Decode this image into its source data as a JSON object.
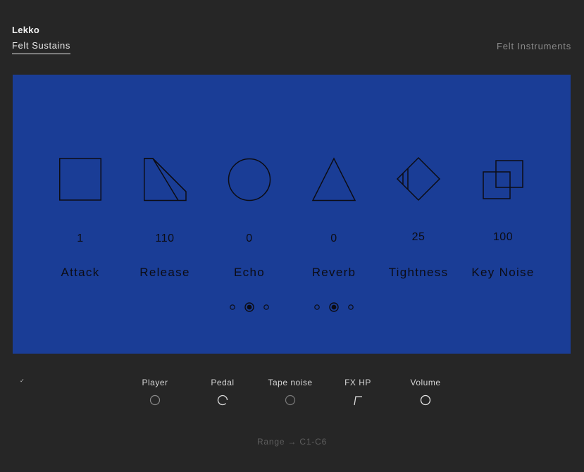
{
  "header": {
    "brand": "Lekko",
    "preset": "Felt Sustains",
    "library": "Felt Instruments"
  },
  "panel": {
    "color": "#1a3d96",
    "params": [
      {
        "label": "Attack",
        "value": "1",
        "icon": "square-icon"
      },
      {
        "label": "Release",
        "value": "110",
        "icon": "slanted-square-icon"
      },
      {
        "label": "Echo",
        "value": "0",
        "icon": "circle-icon"
      },
      {
        "label": "Reverb",
        "value": "0",
        "icon": "triangle-icon"
      },
      {
        "label": "Tightness",
        "value": "25",
        "icon": "diamond-icon"
      },
      {
        "label": "Key Noise",
        "value": "100",
        "icon": "overlapping-squares-icon"
      }
    ],
    "echo_mode": {
      "options": 3,
      "selected": 2
    },
    "reverb_mode": {
      "options": 3,
      "selected": 2
    }
  },
  "footer": {
    "controls": [
      {
        "label": "Player",
        "icon": "player-knob-icon"
      },
      {
        "label": "Pedal",
        "icon": "pedal-knob-icon"
      },
      {
        "label": "Tape noise",
        "icon": "tape-noise-knob-icon"
      },
      {
        "label": "FX HP",
        "icon": "highpass-filter-icon"
      },
      {
        "label": "Volume",
        "icon": "volume-knob-icon"
      }
    ],
    "range": "Range → C1-C6",
    "check_mark": "✓"
  }
}
